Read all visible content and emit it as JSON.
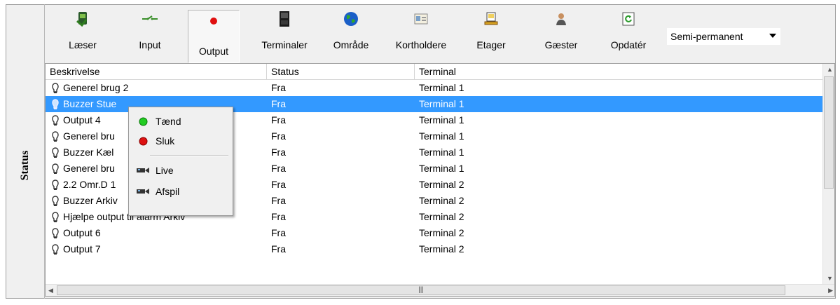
{
  "side_label": "Status",
  "toolbar": {
    "buttons": [
      {
        "label": "Læser",
        "icon": "reader-icon"
      },
      {
        "label": "Input",
        "icon": "input-icon"
      },
      {
        "label": "Output",
        "icon": "output-red-dot-icon",
        "active": true
      },
      {
        "label": "Terminaler",
        "icon": "terminal-icon"
      },
      {
        "label": "Område",
        "icon": "globe-icon"
      },
      {
        "label": "Kortholdere",
        "icon": "cardholder-icon"
      },
      {
        "label": "Etager",
        "icon": "floor-icon"
      },
      {
        "label": "Gæster",
        "icon": "guest-icon"
      },
      {
        "label": "Opdatér",
        "icon": "refresh-icon"
      }
    ],
    "select_value": "Semi-permanent"
  },
  "table": {
    "headers": [
      "Beskrivelse",
      "Status",
      "Terminal"
    ],
    "rows": [
      {
        "desc": "Generel brug 2",
        "status": "Fra",
        "terminal": "Terminal 1"
      },
      {
        "desc": "Buzzer Stue",
        "status": "Fra",
        "terminal": "Terminal 1",
        "selected": true
      },
      {
        "desc": "Output 4",
        "status": "Fra",
        "terminal": "Terminal 1"
      },
      {
        "desc": "Generel bru",
        "status": "Fra",
        "terminal": "Terminal 1"
      },
      {
        "desc": "Buzzer Kæl",
        "status": "Fra",
        "terminal": "Terminal 1"
      },
      {
        "desc": "Generel bru",
        "status": "Fra",
        "terminal": "Terminal 1"
      },
      {
        "desc": "2.2 Omr.D 1",
        "status": "Fra",
        "terminal": "Terminal 2"
      },
      {
        "desc": "Buzzer Arkiv",
        "status": "Fra",
        "terminal": "Terminal 2"
      },
      {
        "desc": "Hjælpe output til alarm Arkiv",
        "status": "Fra",
        "terminal": "Terminal 2"
      },
      {
        "desc": "Output 6",
        "status": "Fra",
        "terminal": "Terminal 2"
      },
      {
        "desc": "Output 7",
        "status": "Fra",
        "terminal": "Terminal 2"
      }
    ]
  },
  "context_menu": {
    "items": [
      {
        "label": "Tænd",
        "icon": "green-dot-icon"
      },
      {
        "label": "Sluk",
        "icon": "red-dot-icon"
      },
      {
        "label": "Live",
        "icon": "camera-icon"
      },
      {
        "label": "Afspil",
        "icon": "camera-play-icon"
      }
    ]
  },
  "colors": {
    "selection": "#3399ff",
    "on": "#22cc22",
    "off": "#dd1111"
  }
}
